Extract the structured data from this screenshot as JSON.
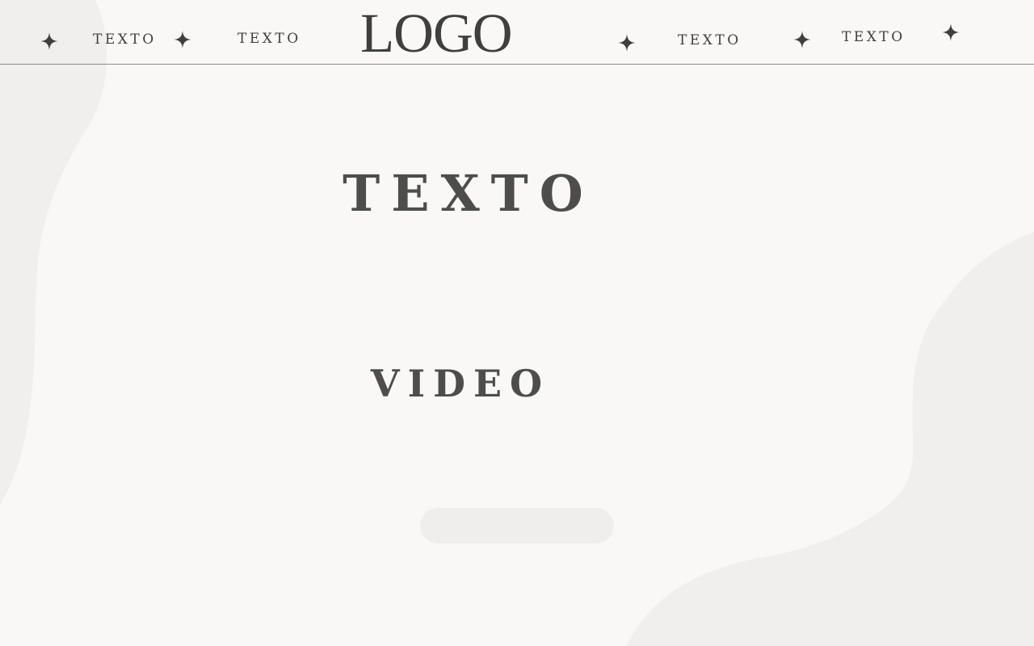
{
  "colors": {
    "background": "#f9f8f6",
    "blob": "#f0efed",
    "text": "#4a4a49",
    "rule": "#8b8b89",
    "button": "#efeeec"
  },
  "header": {
    "logo": "LOGO",
    "nav": [
      {
        "label": "TEXTO",
        "icon": "sparkle-icon"
      },
      {
        "label": "TEXTO",
        "icon": "sparkle-icon"
      },
      {
        "label": "TEXTO",
        "icon": "sparkle-icon"
      },
      {
        "label": "TEXTO",
        "icon": "sparkle-icon"
      }
    ],
    "trailing_icon": "sparkle-icon"
  },
  "hero": {
    "title": "TEXTO",
    "video_label": "VIDEO",
    "button_label": ""
  }
}
